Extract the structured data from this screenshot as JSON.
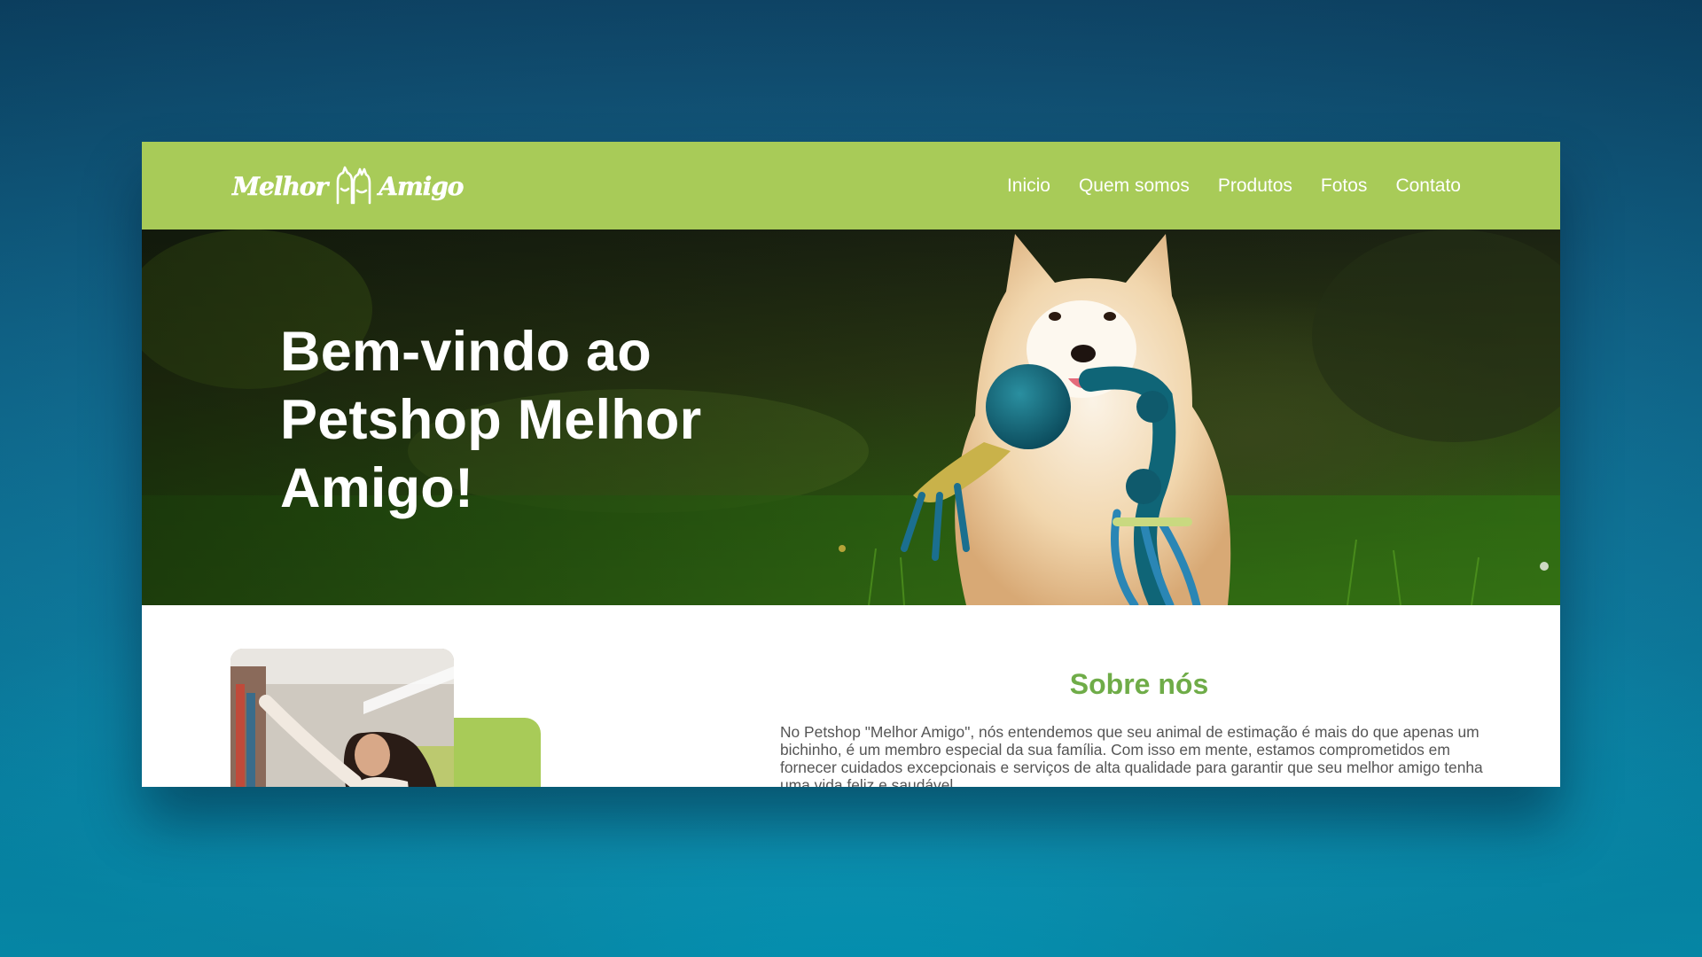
{
  "header": {
    "logo": {
      "text_left": "Melhor",
      "text_right": "Amigo"
    },
    "nav": [
      {
        "label": "Inicio"
      },
      {
        "label": "Quem somos"
      },
      {
        "label": "Produtos"
      },
      {
        "label": "Fotos"
      },
      {
        "label": "Contato"
      }
    ]
  },
  "hero": {
    "title": "Bem-vindo ao Petshop Melhor Amigo!"
  },
  "about": {
    "title": "Sobre nós",
    "text": "No Petshop \"Melhor Amigo\", nós entendemos que seu animal de estimação é mais do que apenas um bichinho, é um membro especial da sua família. Com isso em mente, estamos comprometidos em fornecer cuidados excepcionais e serviços de alta qualidade para garantir que seu melhor amigo tenha uma vida feliz e saudável."
  },
  "colors": {
    "header_bg": "#a8cb58",
    "accent_green": "#6fac48",
    "page_bg": "#0a88b0"
  }
}
